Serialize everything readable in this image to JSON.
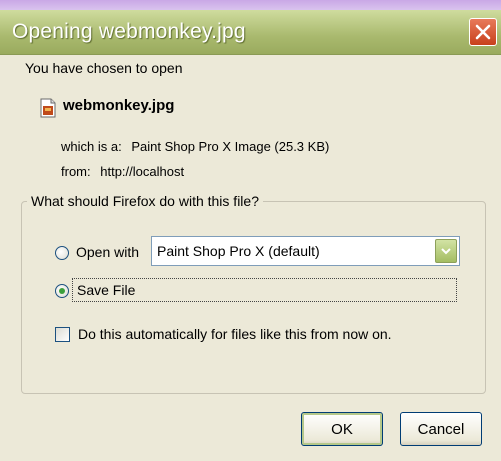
{
  "window": {
    "title": "Opening webmonkey.jpg"
  },
  "intro": "You have chosen to open",
  "file": {
    "name": "webmonkey.jpg",
    "icon": "jpg-file-icon",
    "type_label": "which is a:",
    "type_value": "Paint Shop Pro X Image (25.3 KB)",
    "from_label": "from:",
    "from_value": "http://localhost"
  },
  "action_group": {
    "legend": "What should Firefox do with this file?",
    "open_with_label": "Open with",
    "open_with_app": "Paint Shop Pro X (default)",
    "save_file_label": "Save File",
    "selected": "save_file",
    "auto_label": "Do this automatically for files like this from now on.",
    "auto_checked": false
  },
  "buttons": {
    "ok": "OK",
    "cancel": "Cancel"
  },
  "colors": {
    "titlebar": "#a9b96e",
    "close": "#c8401c",
    "dialog_bg": "#ece9d8"
  }
}
